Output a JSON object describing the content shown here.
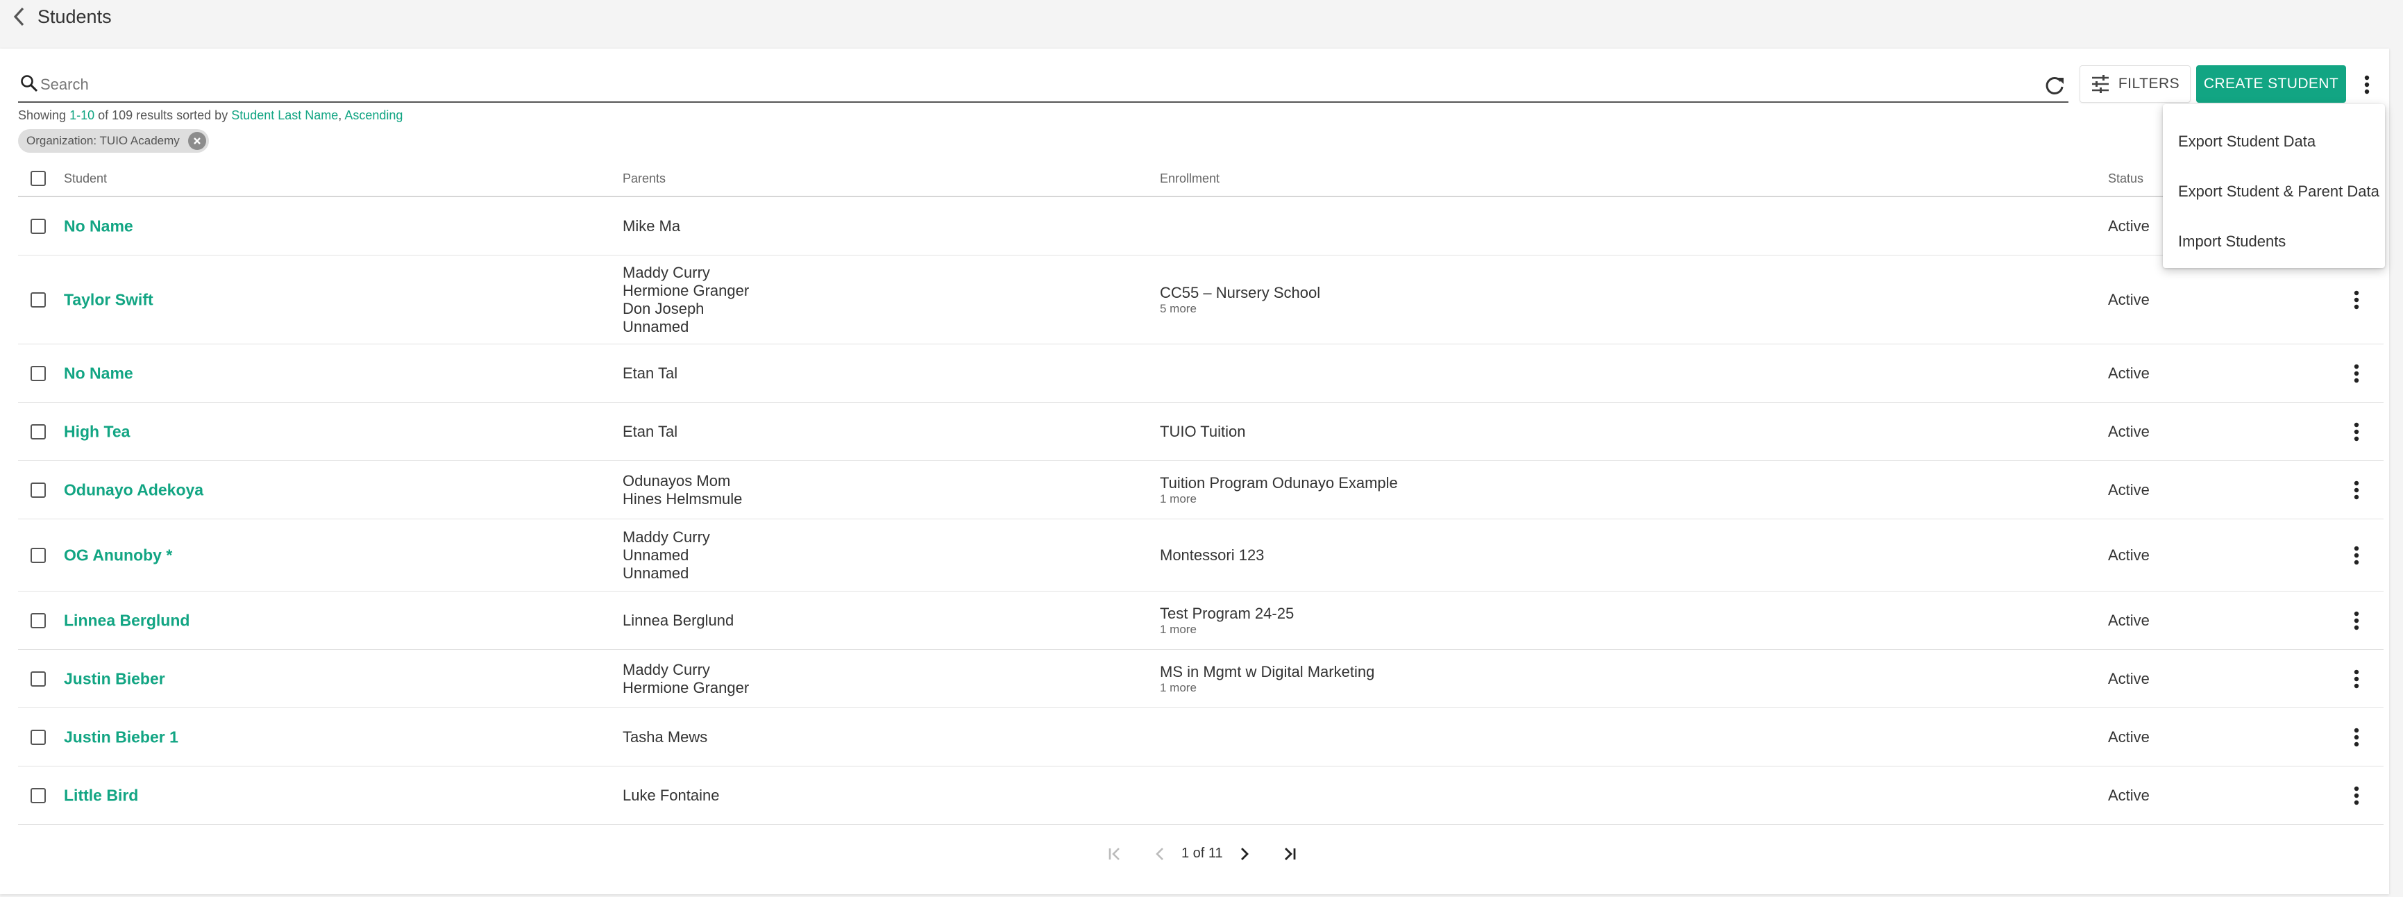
{
  "header": {
    "title": "Students"
  },
  "search": {
    "placeholder": "Search"
  },
  "toolbar": {
    "filters_label": "FILTERS",
    "create_label": "CREATE STUDENT"
  },
  "results": {
    "prefix": "Showing ",
    "range": "1-10",
    "middle": " of 109 results sorted by ",
    "sort_field": "Student Last Name",
    "sep": ", ",
    "sort_dir": "Ascending"
  },
  "filter_chip": {
    "label": "Organization: TUIO Academy"
  },
  "table": {
    "columns": {
      "student": "Student",
      "parents": "Parents",
      "enrollment": "Enrollment",
      "status": "Status"
    },
    "rows": [
      {
        "name": "No Name",
        "parents": [
          "Mike Ma"
        ],
        "enrollment": "",
        "enrollment_more": "",
        "status": "Active"
      },
      {
        "name": "Taylor Swift",
        "parents": [
          "Maddy Curry",
          "Hermione Granger",
          "Don Joseph",
          "Unnamed"
        ],
        "enrollment": "CC55 – Nursery School",
        "enrollment_more": "5 more",
        "status": "Active"
      },
      {
        "name": "No Name",
        "parents": [
          "Etan Tal"
        ],
        "enrollment": "",
        "enrollment_more": "",
        "status": "Active"
      },
      {
        "name": "High Tea",
        "parents": [
          "Etan Tal"
        ],
        "enrollment": "TUIO Tuition",
        "enrollment_more": "",
        "status": "Active"
      },
      {
        "name": "Odunayo Adekoya",
        "parents": [
          "Odunayos Mom",
          "Hines Helmsmule"
        ],
        "enrollment": "Tuition Program Odunayo Example",
        "enrollment_more": "1 more",
        "status": "Active"
      },
      {
        "name": "OG Anunoby *",
        "parents": [
          "Maddy Curry",
          "Unnamed",
          "Unnamed"
        ],
        "enrollment": "Montessori 123",
        "enrollment_more": "",
        "status": "Active"
      },
      {
        "name": "Linnea Berglund",
        "parents": [
          "Linnea Berglund"
        ],
        "enrollment": "Test Program 24-25",
        "enrollment_more": "1 more",
        "status": "Active"
      },
      {
        "name": "Justin Bieber",
        "parents": [
          "Maddy Curry",
          "Hermione Granger"
        ],
        "enrollment": "MS in Mgmt w Digital Marketing",
        "enrollment_more": "1 more",
        "status": "Active"
      },
      {
        "name": "Justin Bieber 1",
        "parents": [
          "Tasha Mews"
        ],
        "enrollment": "",
        "enrollment_more": "",
        "status": "Active"
      },
      {
        "name": "Little Bird",
        "parents": [
          "Luke Fontaine"
        ],
        "enrollment": "",
        "enrollment_more": "",
        "status": "Active"
      }
    ]
  },
  "pagination": {
    "label": "1 of 11"
  },
  "menu": {
    "items": [
      "Export Student Data",
      "Export Student & Parent Data",
      "Import Students"
    ]
  },
  "colors": {
    "accent": "#12a583",
    "link": "#12a583"
  },
  "icons": {
    "back": "chevron-left-icon",
    "search": "search-icon",
    "refresh": "refresh-icon",
    "filters": "tune-icon",
    "more": "more-vert-icon",
    "chip_close": "close-circle-icon"
  }
}
